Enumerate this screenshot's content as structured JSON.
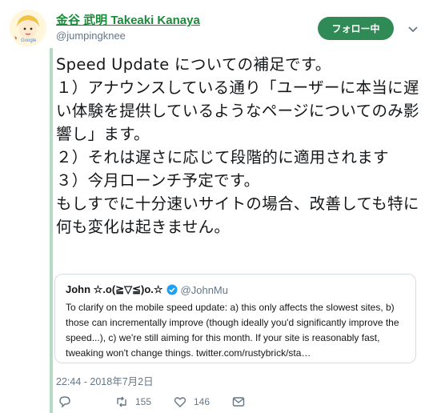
{
  "author": {
    "display_name": "金谷 武明 Takeaki Kanaya",
    "handle": "@jumpingknee",
    "avatar_badge": "Google"
  },
  "follow_button_label": "フォロー中",
  "tweet_text": "Speed Update についての補足です。\n１）アナウンスしている通り「ユーザーに本当に遅い体験を提供しているようなページについてのみ影響し」ます。\n２）それは遅さに応じて段階的に適用されます\n３）今月ローンチ予定です。\nもしすでに十分速いサイトの場合、改善しても特に何も変化は起きません。",
  "quoted_tweet": {
    "name": "John ☆.o(≧▽≦)o.☆",
    "handle": "@JohnMu",
    "text": "To clarify on the mobile speed update: a) this only affects the slowest sites, b) those can incrementally improve (though ideally you'd significantly improve the speed...), c) we're still aiming for this month. If your site is reasonably fast, tweaking won't change things. twitter.com/rustybrick/sta…"
  },
  "timestamp": "22:44 - 2018年7月2日",
  "actions": {
    "reply_count": "",
    "retweet_count": "155",
    "like_count": "146"
  },
  "colors": {
    "accent": "#2f8a55",
    "name_link": "#1a8a3a",
    "muted": "#657786",
    "verified": "#1da1f2"
  }
}
